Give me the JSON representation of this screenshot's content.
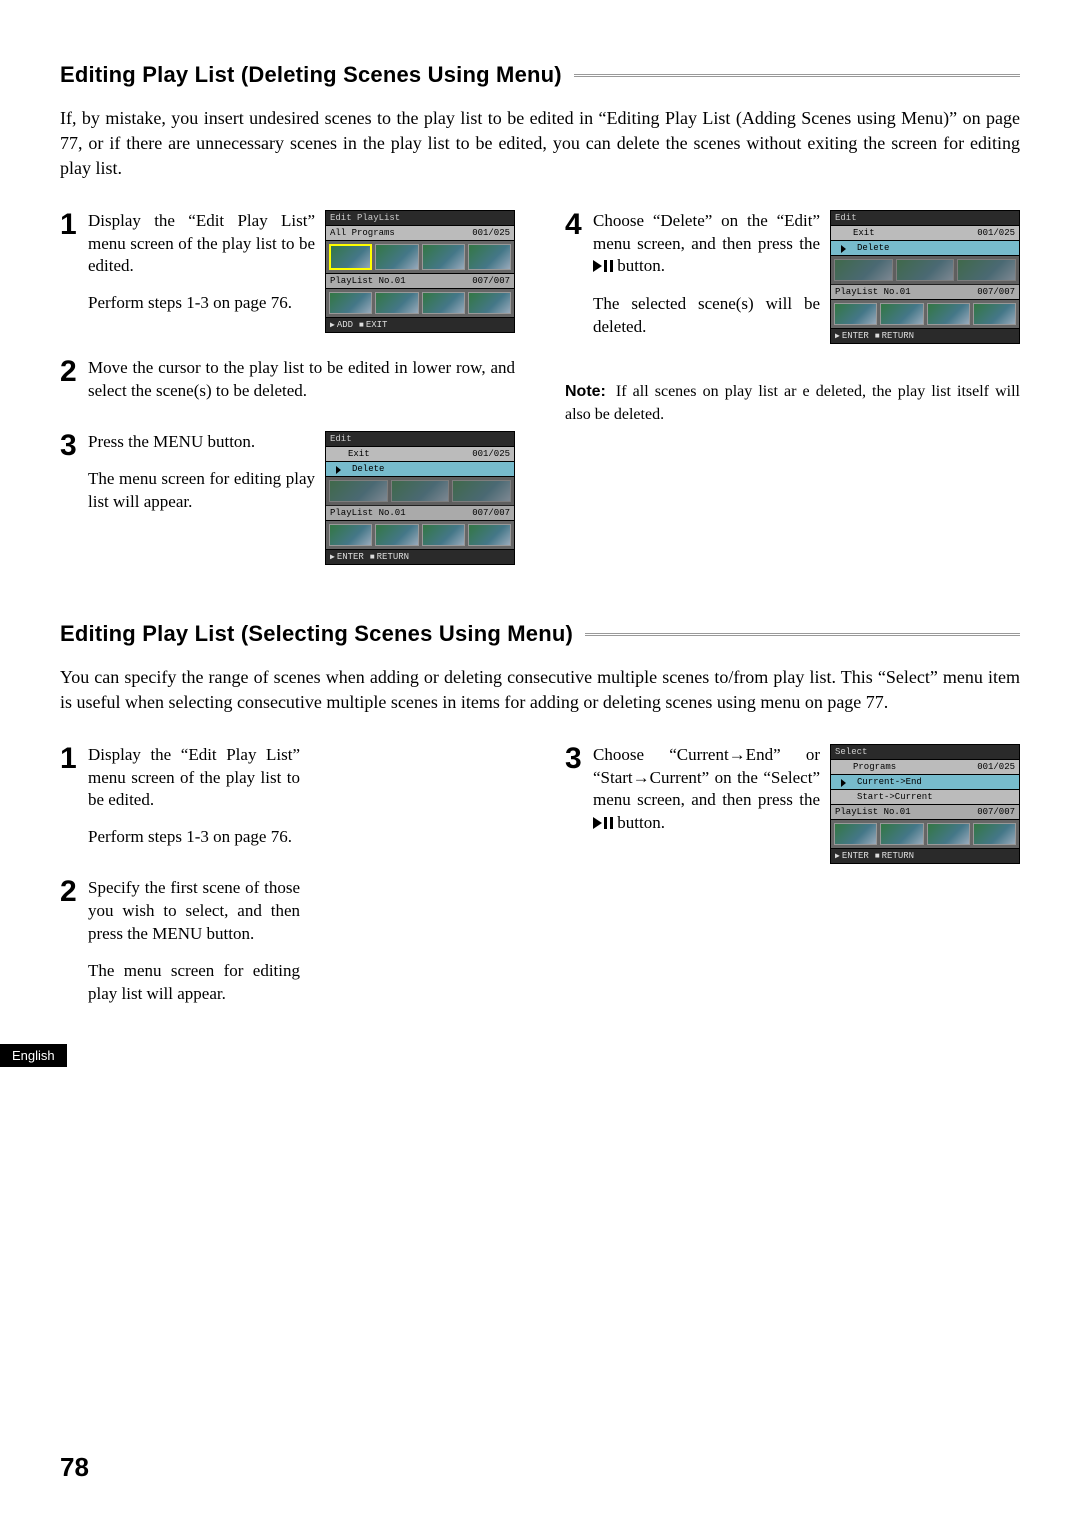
{
  "section1": {
    "heading": "Editing Play List (Deleting Scenes Using Menu)",
    "intro": "If, by mistake, you insert undesired scenes to the play list to be edited in “Editing Play List (Adding Scenes using Menu)” on page 77, or if there are unnecessary scenes in the play list to be edited, you can delete the scenes without exiting the screen for editing play list.",
    "step1": {
      "p1": "Display the “Edit Play List” menu screen of the play list to be edited.",
      "p2": "Perform steps 1-3 on page 76."
    },
    "step2": {
      "p1": "Move the cursor to the play list to be edited in lower row, and select the scene(s) to be deleted."
    },
    "step3": {
      "p1": "Press the MENU button.",
      "p2": "The menu screen for editing play list will appear."
    },
    "step4": {
      "p1_a": "Choose “Delete” on the “Edit” menu screen, and then press the",
      "p1_b": " button.",
      "p2": "The selected scene(s) will be deleted."
    },
    "note_label": "Note:",
    "note_text": "If all scenes on play list ar e deleted, the play list itself will also be deleted.",
    "fig1": {
      "title": "Edit PlayList",
      "row_all": "All Programs",
      "row_all_cnt": "001/025",
      "mid_left": "PlayList No.01",
      "mid_cnt": "007/007",
      "foot_add": "ADD",
      "foot_exit": "EXIT"
    },
    "fig2": {
      "title": "Edit",
      "exit": "Exit",
      "delete": "Delete",
      "cnt": "001/025",
      "mid_left": "PlayList No.01",
      "mid_cnt": "007/007",
      "foot_enter": "ENTER",
      "foot_return": "RETURN"
    },
    "fig3": {
      "title": "Edit",
      "exit": "Exit",
      "delete": "Delete",
      "cnt": "001/025",
      "mid_left": "PlayList No.01",
      "mid_cnt": "007/007",
      "foot_enter": "ENTER",
      "foot_return": "RETURN"
    }
  },
  "section2": {
    "heading": "Editing Play List (Selecting Scenes Using Menu)",
    "intro": "You can specify the range of scenes when adding or deleting consecutive multiple scenes to/from play list. This “Select” menu item is useful when selecting consecutive multiple scenes in items for adding or deleting scenes using menu on page 77.",
    "step1": {
      "p1": "Display the “Edit Play List” menu screen of the play list to be edited.",
      "p2": "Perform steps 1-3 on page 76."
    },
    "step2": {
      "p1": "Specify the first scene of those you wish to select, and then press the MENU button.",
      "p2": "The menu screen for editing play list will appear."
    },
    "step3": {
      "p1_a": "Choose “Current→End” or “Start→Current” on the “Select” menu screen, and then press the",
      "p1_b": " button."
    },
    "fig1": {
      "title": "Select",
      "row1": "Programs",
      "cnt": "001/025",
      "row2": "Current->End",
      "row3": "Start->Current",
      "mid_left": "PlayList No.01",
      "mid_cnt": "007/007",
      "foot_enter": "ENTER",
      "foot_return": "RETURN"
    }
  },
  "lang_tab": "English",
  "page_number": "78"
}
